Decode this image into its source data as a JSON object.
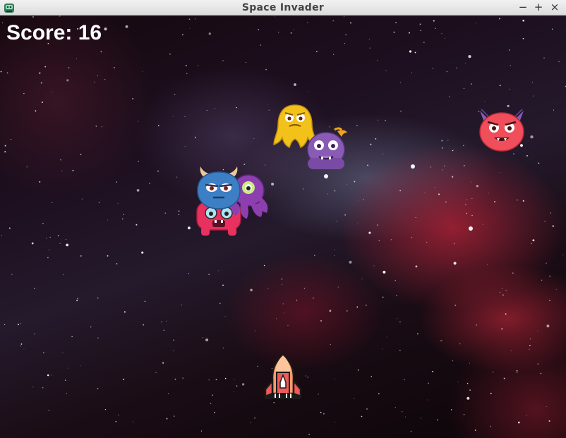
{
  "window": {
    "title": "Space Invader",
    "icon": "robot-app-icon",
    "controls": {
      "minimize": "−",
      "maximize": "+",
      "close": "×"
    }
  },
  "hud": {
    "score_label": "Score: 16"
  },
  "sprites": {
    "aliens": [
      {
        "name": "yellow-alien",
        "color": "#f2c21b"
      },
      {
        "name": "purple-alien",
        "color": "#8a5bb5"
      },
      {
        "name": "red-winged-alien",
        "color": "#ef4e5a"
      },
      {
        "name": "blue-horned-alien",
        "color": "#3d7fc4"
      },
      {
        "name": "purple-octopus-alien",
        "color": "#8d3fb0"
      },
      {
        "name": "pink-alien",
        "color": "#e8315e"
      }
    ],
    "player": {
      "name": "rocket-ship",
      "colors": [
        "#ff9b6a",
        "#f05a5a",
        "#ffffff"
      ]
    }
  }
}
